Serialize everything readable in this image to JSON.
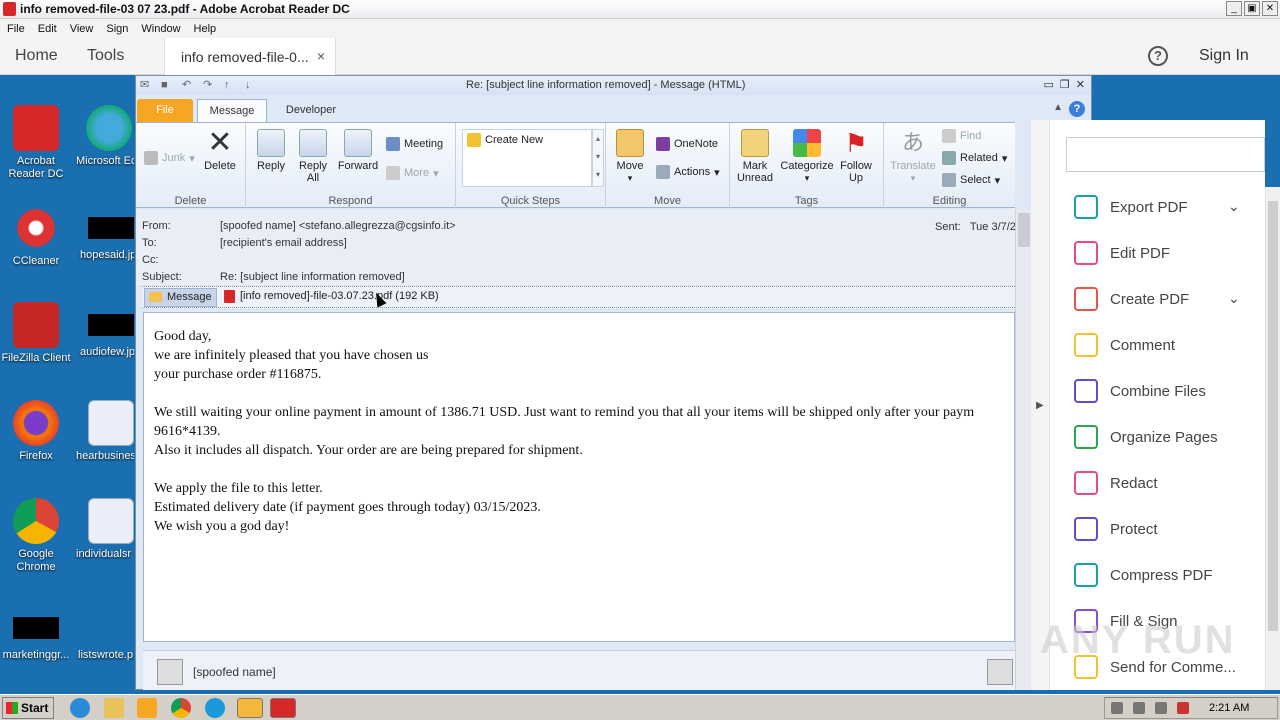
{
  "window": {
    "title": "info removed-file-03 07 23.pdf - Adobe Acrobat Reader DC",
    "buttons": [
      "_",
      "▣",
      "✕"
    ]
  },
  "menu": [
    "File",
    "Edit",
    "View",
    "Sign",
    "Window",
    "Help"
  ],
  "acrobat_tabs": {
    "home": "Home",
    "tools": "Tools",
    "document_tab": "info removed-file-0...",
    "close": "×",
    "help": "?",
    "sign_in": "Sign In"
  },
  "desktop": {
    "icons": [
      {
        "label": "Acrobat Reader DC",
        "icon": "acrobat-icon"
      },
      {
        "label": "Microsoft Ed",
        "icon": "edge-icon"
      },
      {
        "label": "CCleaner",
        "icon": "ccleaner-icon"
      },
      {
        "label": "hopesaid.jp",
        "icon": "redacted-file-icon"
      },
      {
        "label": "FileZilla Client",
        "icon": "filezilla-icon"
      },
      {
        "label": "audiofew.jp",
        "icon": "redacted-file-icon"
      },
      {
        "label": "Firefox",
        "icon": "firefox-icon"
      },
      {
        "label": "hearbusines",
        "icon": "word-doc-icon"
      },
      {
        "label": "Google Chrome",
        "icon": "chrome-icon"
      },
      {
        "label": "individualsr",
        "icon": "word-doc-icon"
      },
      {
        "label": "marketinggr...",
        "icon": "redacted-file-icon"
      },
      {
        "label": "listswrote.p",
        "icon": "file-icon"
      }
    ]
  },
  "outlook": {
    "title": "Re: [subject line information removed]  -  Message (HTML)",
    "tabs": {
      "file": "File",
      "message": "Message",
      "developer": "Developer"
    },
    "ribbon": {
      "delete_group": {
        "label": "Delete",
        "junk": "Junk",
        "delete": "Delete"
      },
      "respond_group": {
        "label": "Respond",
        "reply": "Reply",
        "reply_all": "Reply All",
        "forward": "Forward",
        "meeting": "Meeting",
        "more": "More"
      },
      "quick_steps_group": {
        "label": "Quick Steps",
        "create_new": "Create New"
      },
      "move_group": {
        "label": "Move",
        "move": "Move",
        "onenote": "OneNote",
        "actions": "Actions"
      },
      "tags_group": {
        "label": "Tags",
        "mark_unread": "Mark Unread",
        "categorize": "Categorize",
        "follow_up": "Follow Up"
      },
      "editing_group": {
        "label": "Editing",
        "translate": "Translate",
        "find": "Find",
        "related": "Related",
        "select": "Select"
      }
    },
    "header": {
      "from_label": "From:",
      "from_value": "[spoofed name] <stefano.allegrezza@cgsinfo.it>",
      "to_label": "To:",
      "to_value": "[recipient's email address]",
      "cc_label": "Cc:",
      "cc_value": "",
      "subject_label": "Subject:",
      "subject_value": "Re: [subject line information removed]",
      "sent_label": "Sent:",
      "sent_value": "Tue 3/7/2"
    },
    "attachments": {
      "message_button": "Message",
      "file": "[info removed]-file-03.07.23.pdf (192 KB)"
    },
    "body": [
      "Good day,",
      "we are infinitely pleased that you have chosen us",
      "your purchase order #116875.",
      "",
      "We still waiting your online payment in amount of 1386.71 USD. Just want to remind you that all your items will be shipped only after your paym",
      "9616*4139.",
      "Also it includes all dispatch. Your order are are being prepared for shipment.",
      "",
      "We apply the file to this letter.",
      "Estimated delivery date (if payment goes through today) 03/15/2023.",
      "We wish you a god day!"
    ],
    "people_pane": {
      "name": "[spoofed name]"
    }
  },
  "acrobat_tools": [
    {
      "label": "Export PDF",
      "icon": "export-pdf-icon",
      "color": "#1b9fa8",
      "expand": true
    },
    {
      "label": "Edit PDF",
      "icon": "edit-pdf-icon",
      "color": "#e44b8d",
      "expand": false
    },
    {
      "label": "Create PDF",
      "icon": "create-pdf-icon",
      "color": "#e2574c",
      "expand": true
    },
    {
      "label": "Comment",
      "icon": "comment-icon",
      "color": "#f2c233",
      "expand": false
    },
    {
      "label": "Combine Files",
      "icon": "combine-files-icon",
      "color": "#5a50c8",
      "expand": false
    },
    {
      "label": "Organize Pages",
      "icon": "organize-pages-icon",
      "color": "#2da44e",
      "expand": false
    },
    {
      "label": "Redact",
      "icon": "redact-icon",
      "color": "#e44b8d",
      "expand": false
    },
    {
      "label": "Protect",
      "icon": "protect-icon",
      "color": "#5a50c8",
      "expand": false
    },
    {
      "label": "Compress PDF",
      "icon": "compress-pdf-icon",
      "color": "#1b9fa8",
      "expand": false
    },
    {
      "label": "Fill & Sign",
      "icon": "fill-sign-icon",
      "color": "#8a4fd1",
      "expand": false
    },
    {
      "label": "Send for Comme...",
      "icon": "send-for-comment-icon",
      "color": "#f2c233",
      "expand": false
    }
  ],
  "taskbar": {
    "start": "Start",
    "clock": "2:21 AM"
  },
  "watermark": "ANY RUN"
}
